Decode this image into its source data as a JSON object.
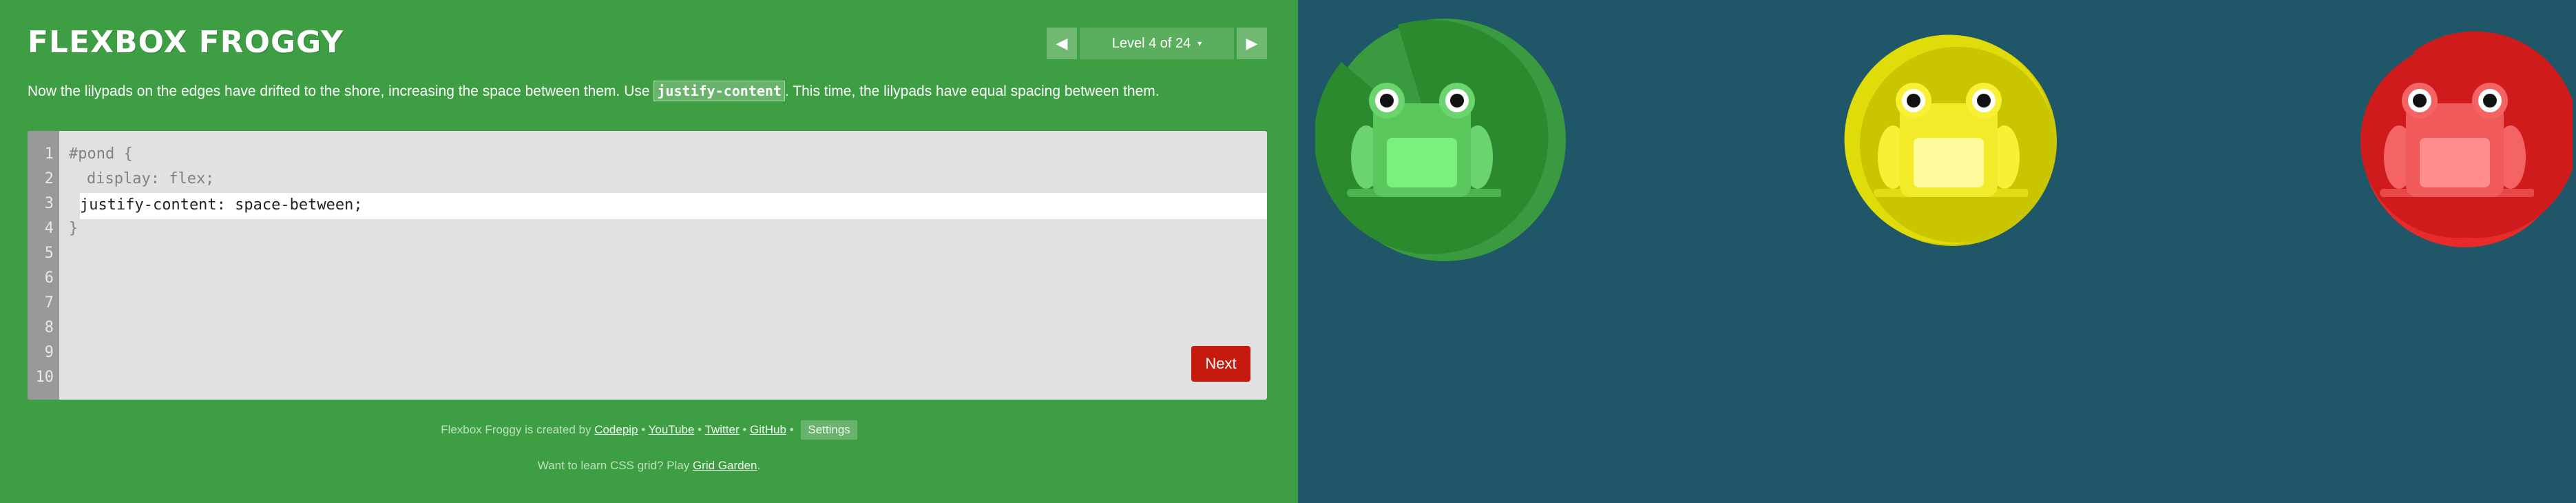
{
  "title": "FLEXBOX FROGGY",
  "level": {
    "prev_icon": "triangle-left-icon",
    "next_icon": "triangle-right-icon",
    "indicator": "Level 4 of 24",
    "caret": "▾"
  },
  "instructions": {
    "before": "Now the lilypads on the edges have drifted to the shore, increasing the space between them. Use ",
    "code": "justify-content",
    "after": ". This time, the lilypads have equal spacing between them."
  },
  "editor": {
    "line_numbers": [
      "1",
      "2",
      "3",
      "4",
      "5",
      "6",
      "7",
      "8",
      "9",
      "10"
    ],
    "line1": "#pond {",
    "line2": "display: flex;",
    "input_value": "justify-content: space-between;",
    "closing": "}",
    "next_label": "Next"
  },
  "footer": {
    "prefix": "Flexbox Froggy is created by",
    "link_codepip": "Codepip",
    "link_youtube": "YouTube",
    "link_twitter": "Twitter",
    "link_github": "GitHub",
    "sep": "•",
    "settings": "Settings",
    "grid_prefix": "Want to learn CSS grid? Play",
    "grid_link": "Grid Garden",
    "grid_suffix": "."
  },
  "pond": {
    "frogs": [
      "green",
      "yellow",
      "red"
    ]
  },
  "colors": {
    "sidebar_bg": "#3e9e44",
    "pond_bg": "#1f5768",
    "next_button": "#c51b0f",
    "green_pad": "#2c8a2e",
    "yellow_pad": "#c9c500",
    "red_pad": "#cf1b1b"
  }
}
